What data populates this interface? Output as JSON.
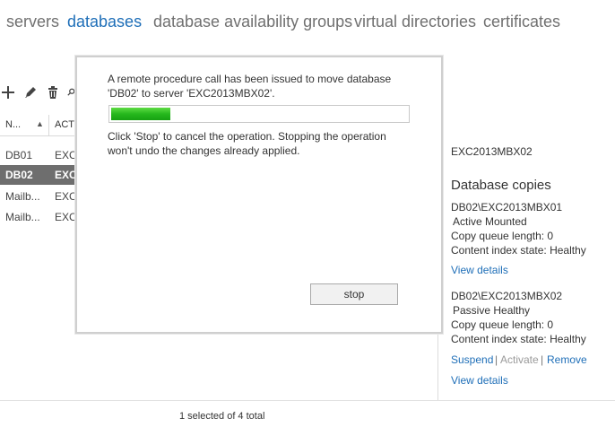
{
  "nav": {
    "tabs": [
      {
        "label": "servers"
      },
      {
        "label": "databases"
      },
      {
        "label": "database availability groups"
      },
      {
        "label": "virtual directories"
      },
      {
        "label": "certificates"
      }
    ],
    "active_color": "#1f6fb8"
  },
  "toolbar": {
    "icons": [
      "add-icon",
      "edit-icon",
      "delete-icon",
      "search-icon"
    ]
  },
  "list": {
    "columns": [
      {
        "label": "N...",
        "sort": "ascending"
      },
      {
        "label": "ACTI"
      }
    ],
    "rows": [
      {
        "name": "DB01",
        "server": "EXC",
        "selected": false
      },
      {
        "name": "DB02",
        "server": "EXC",
        "selected": true
      },
      {
        "name": "Mailb...",
        "server": "EXC",
        "selected": false
      },
      {
        "name": "Mailb...",
        "server": "EXC",
        "selected": false
      }
    ],
    "status": "1 selected of 4 total"
  },
  "details": {
    "server": "EXC2013MBX02",
    "copies_heading": "Database copies",
    "copies": [
      {
        "name": "DB02\\EXC2013MBX01",
        "status": "Active Mounted",
        "queue": "Copy queue length:  0",
        "index": "Content index state:  Healthy",
        "view_details": "View details"
      },
      {
        "name": "DB02\\EXC2013MBX02",
        "status": "Passive Healthy",
        "queue": "Copy queue length:  0",
        "index": "Content index state:  Healthy",
        "suspend": "Suspend",
        "separator": "|",
        "activate": "Activate",
        "remove": "Remove",
        "view_details": "View details"
      }
    ]
  },
  "dialog": {
    "message": "A remote procedure call has been issued to move database 'DB02' to server 'EXC2013MBX02'.",
    "progress_fraction": 0.2,
    "note": "Click 'Stop' to cancel the operation. Stopping the operation won't undo the changes already applied.",
    "stop_label": "stop"
  }
}
